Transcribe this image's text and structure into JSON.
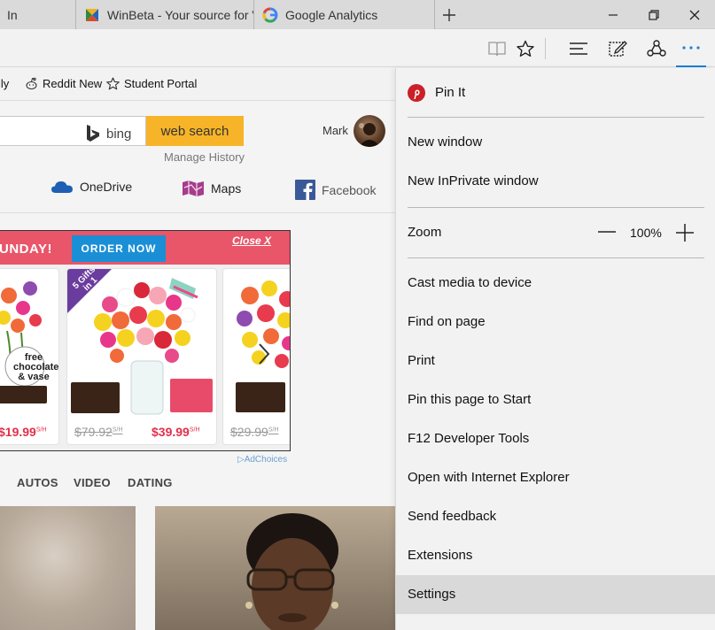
{
  "tabs": [
    {
      "label": "In",
      "icon": "none"
    },
    {
      "label": "WinBeta - Your source for V",
      "icon": "winbeta-favicon-icon"
    },
    {
      "label": "Google Analytics",
      "icon": "google-g-icon"
    }
  ],
  "window_controls": {
    "minimize": "minimize-icon",
    "restore": "restore-icon",
    "close": "close-icon"
  },
  "toolbar": {
    "icons": [
      "reading-view-icon",
      "favorites-star-icon",
      "hub-icon",
      "web-note-icon",
      "share-icon",
      "more-actions-icon"
    ]
  },
  "favorites": [
    {
      "label": "ily"
    },
    {
      "label": "Reddit New",
      "icon": "reddit-icon"
    },
    {
      "label": "Student Portal",
      "icon": "star-outline-icon"
    }
  ],
  "search": {
    "value": "",
    "engine": "bing",
    "button": "web search",
    "manage_history": "Manage History"
  },
  "user": {
    "name": "Mark"
  },
  "quick_links": [
    {
      "label": "OneDrive",
      "icon": "onedrive-icon",
      "color": "#1e5fb4"
    },
    {
      "label": "Maps",
      "icon": "maps-icon",
      "color": "#a53c8c"
    },
    {
      "label": "Facebook",
      "icon": "facebook-icon",
      "color": "#3b5998"
    }
  ],
  "ad": {
    "headline": "UNDAY!",
    "order_button": "ORDER NOW",
    "close": "Close X",
    "badge": "5 Gifts in 1",
    "free_tag": "free chocolates & vase",
    "prices": [
      {
        "old": "",
        "new": "$19.99",
        "sh": "S/H"
      },
      {
        "old": "$79.92",
        "old_sh": "S/H",
        "new": "$39.99",
        "sh": "S/H"
      },
      {
        "old": "$29.99",
        "old_sh": "S/H",
        "new": "",
        "sh": ""
      }
    ],
    "adchoices": "AdChoices"
  },
  "categories": [
    "AUTOS",
    "VIDEO",
    "DATING"
  ],
  "menu": {
    "pin_it": "Pin It",
    "new_window": "New window",
    "new_inprivate": "New InPrivate window",
    "zoom_label": "Zoom",
    "zoom_value": "100%",
    "cast": "Cast media to device",
    "find": "Find on page",
    "print": "Print",
    "pin_start": "Pin this page to Start",
    "f12": "F12 Developer Tools",
    "open_ie": "Open with Internet Explorer",
    "feedback": "Send feedback",
    "extensions": "Extensions",
    "settings": "Settings"
  },
  "colors": {
    "accent": "#1e7fd6",
    "websearch": "#f7b428",
    "ad_banner": "#e95569",
    "pinterest": "#cb2027"
  }
}
